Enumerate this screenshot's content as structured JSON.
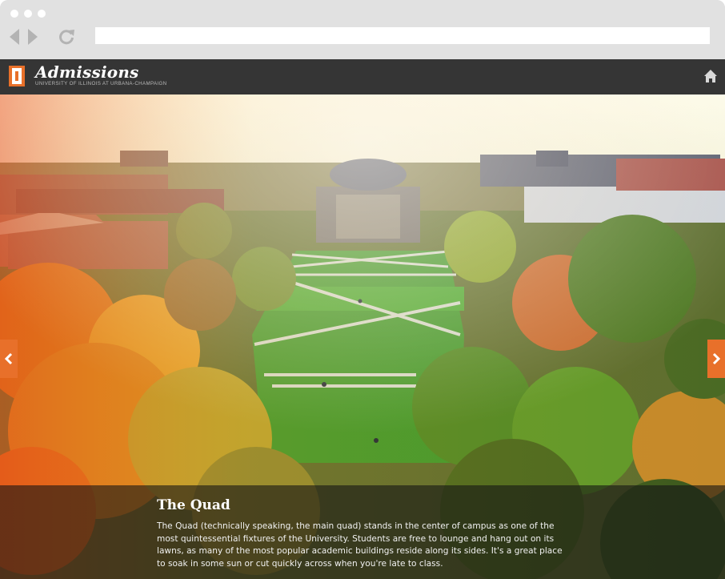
{
  "browser": {
    "address_value": "",
    "icons": [
      "back-icon",
      "forward-icon",
      "reload-icon"
    ]
  },
  "header": {
    "title": "Admissions",
    "subtitle": "UNIVERSITY OF ILLINOIS AT URBANA-CHAMPAIGN",
    "home_icon": "home-icon",
    "background": "#353535"
  },
  "slide": {
    "title": "The Quad",
    "description": "The Quad (technically speaking, the main quad) stands in the center of campus as one of the most quintessential fixtures of the University. Students are free to lounge and hang out on its lawns, as many of the most popular academic buildings reside along its sides. It's a great place to soak in some sun or cut quickly across when you're late to class.",
    "prev_icon": "chevron-left-icon",
    "next_icon": "chevron-right-icon"
  },
  "colors": {
    "accent": "#e8702a",
    "chrome": "#e1e1e1"
  }
}
